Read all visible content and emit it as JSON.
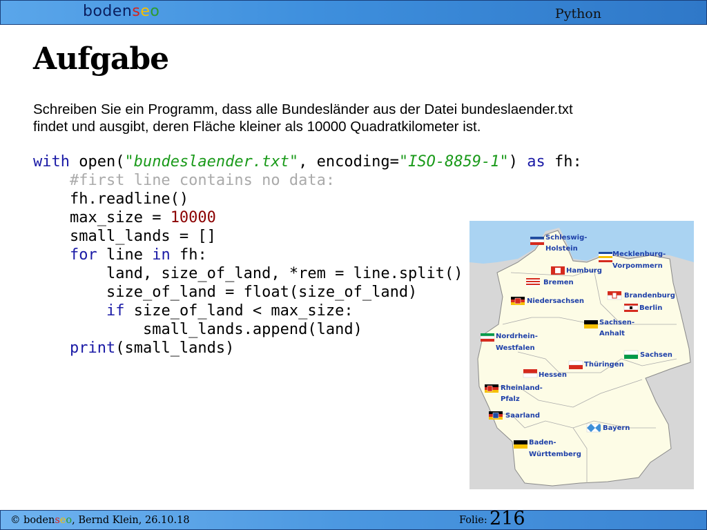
{
  "header": {
    "logo": {
      "a": "boden",
      "s": "s",
      "e": "e",
      "o": "o"
    },
    "topic": "Python"
  },
  "slide": {
    "title": "Aufgabe",
    "text_line1": "Schreiben Sie ein Programm, dass alle Bundesländer aus der Datei bundeslaender.txt",
    "text_line2": "findet und ausgibt, deren Fläche kleiner als 10000 Quadratkilometer ist."
  },
  "code": {
    "l1": {
      "kw1": "with",
      "t1": " open(",
      "s1": "\"bundeslaender.txt\"",
      "t2": ", encoding=",
      "s2": "\"ISO-8859-1\"",
      "t3": ") ",
      "kw2": "as",
      "t4": " fh:"
    },
    "l2": {
      "indent": "    ",
      "comment": "#first line contains no data:"
    },
    "l3": {
      "indent": "    ",
      "text": "fh.readline()"
    },
    "l4": {
      "indent": "    ",
      "text": "max_size = ",
      "num": "10000"
    },
    "l5": {
      "indent": "    ",
      "text": "small_lands = []"
    },
    "l6": {
      "indent": "    ",
      "kw1": "for",
      "t1": " line ",
      "kw2": "in",
      "t2": " fh:"
    },
    "l7": {
      "indent": "        ",
      "text": "land, size_of_land, *rem = line.split()"
    },
    "l8": {
      "indent": "        ",
      "text": "size_of_land = float(size_of_land)"
    },
    "l9": {
      "indent": "        ",
      "kw1": "if",
      "t1": " size_of_land < max_size:"
    },
    "l10": {
      "indent": "            ",
      "text": "small_lands.append(land)"
    },
    "l11": {
      "indent": "    ",
      "kw1": "print",
      "t1": "(small_lands)"
    }
  },
  "map": {
    "labels": {
      "sh1": "Schleswig-",
      "sh2": "Holstein",
      "mv1": "Mecklenburg-",
      "mv2": "Vorpommern",
      "hh": "Hamburg",
      "hb": "Bremen",
      "ni": "Niedersachsen",
      "bb": "Brandenburg",
      "be": "Berlin",
      "st1": "Sachsen-",
      "st2": "Anhalt",
      "nw1": "Nordrhein-",
      "nw2": "Westfalen",
      "sn": "Sachsen",
      "th": "Thüringen",
      "he": "Hessen",
      "rp1": "Rheinland-",
      "rp2": "Pfalz",
      "sl": "Saarland",
      "by": "Bayern",
      "bw1": "Baden-",
      "bw2": "Württemberg"
    }
  },
  "footer": {
    "copyright": "© ",
    "logo": {
      "a": "boden",
      "s": "s",
      "e": "e",
      "o": "o"
    },
    "author_date": ", Bernd Klein, 26.10.18",
    "folie_label": "Folie:",
    "page": "216"
  },
  "colors": {
    "header_blue": "#3e8fdd",
    "keyword": "#1a1aa6",
    "string": "#1a9a1a",
    "number": "#8b0000",
    "comment": "#aaaaaa"
  }
}
